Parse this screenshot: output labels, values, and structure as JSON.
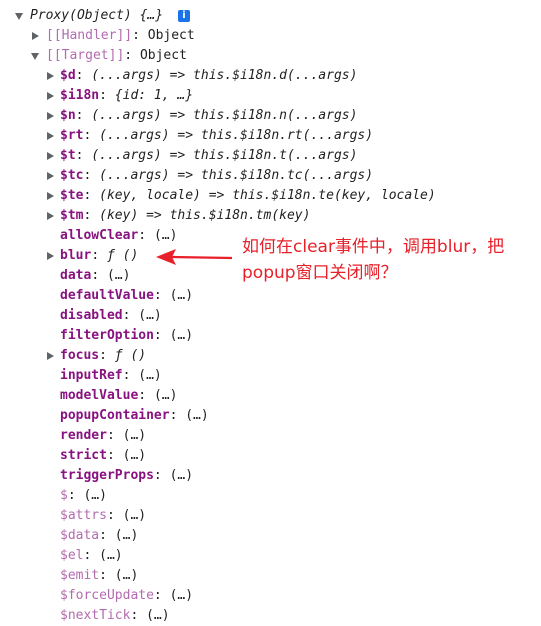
{
  "root": {
    "label": "Proxy(Object) {…}",
    "info_glyph": "i"
  },
  "handler": {
    "key": "[[Handler]]",
    "sep": ": ",
    "value": "Object"
  },
  "target": {
    "key": "[[Target]]",
    "sep": ": ",
    "value": "Object"
  },
  "props": [
    {
      "key": "$d",
      "sep": ": ",
      "value": "(...args) => this.$i18n.d(...args)"
    },
    {
      "key": "$i18n",
      "sep": ": ",
      "value": "{id: 1, …}"
    },
    {
      "key": "$n",
      "sep": ": ",
      "value": "(...args) => this.$i18n.n(...args)"
    },
    {
      "key": "$rt",
      "sep": ": ",
      "value": "(...args) => this.$i18n.rt(...args)"
    },
    {
      "key": "$t",
      "sep": ": ",
      "value": "(...args) => this.$i18n.t(...args)"
    },
    {
      "key": "$tc",
      "sep": ": ",
      "value": "(...args) => this.$i18n.tc(...args)"
    },
    {
      "key": "$te",
      "sep": ": ",
      "value": "(key, locale) => this.$i18n.te(key, locale)"
    },
    {
      "key": "$tm",
      "sep": ": ",
      "value": "(key) => this.$i18n.tm(key)"
    }
  ],
  "getters": [
    {
      "key": "allowClear",
      "value": "(…)"
    },
    {
      "key": "blur",
      "value": "ƒ ()",
      "expandable": true
    },
    {
      "key": "data",
      "value": "(…)"
    },
    {
      "key": "defaultValue",
      "value": "(…)"
    },
    {
      "key": "disabled",
      "value": "(…)"
    },
    {
      "key": "filterOption",
      "value": "(…)"
    },
    {
      "key": "focus",
      "value": "ƒ ()",
      "expandable": true
    },
    {
      "key": "inputRef",
      "value": "(…)"
    },
    {
      "key": "modelValue",
      "value": "(…)"
    },
    {
      "key": "popupContainer",
      "value": "(…)"
    },
    {
      "key": "render",
      "value": "(…)"
    },
    {
      "key": "strict",
      "value": "(…)"
    },
    {
      "key": "triggerProps",
      "value": "(…)"
    },
    {
      "key": "$",
      "value": "(…)"
    },
    {
      "key": "$attrs",
      "value": "(…)"
    },
    {
      "key": "$data",
      "value": "(…)"
    },
    {
      "key": "$el",
      "value": "(…)"
    },
    {
      "key": "$emit",
      "value": "(…)"
    },
    {
      "key": "$forceUpdate",
      "value": "(…)"
    },
    {
      "key": "$nextTick",
      "value": "(…)"
    }
  ],
  "getter_sep": ": ",
  "annotation": {
    "line1": "如何在clear事件中，调用blur，把",
    "line2": "popup窗口关闭啊？"
  },
  "colors": {
    "annotation": "#e8202a",
    "key": "#881280",
    "info": "#1a73e8"
  }
}
